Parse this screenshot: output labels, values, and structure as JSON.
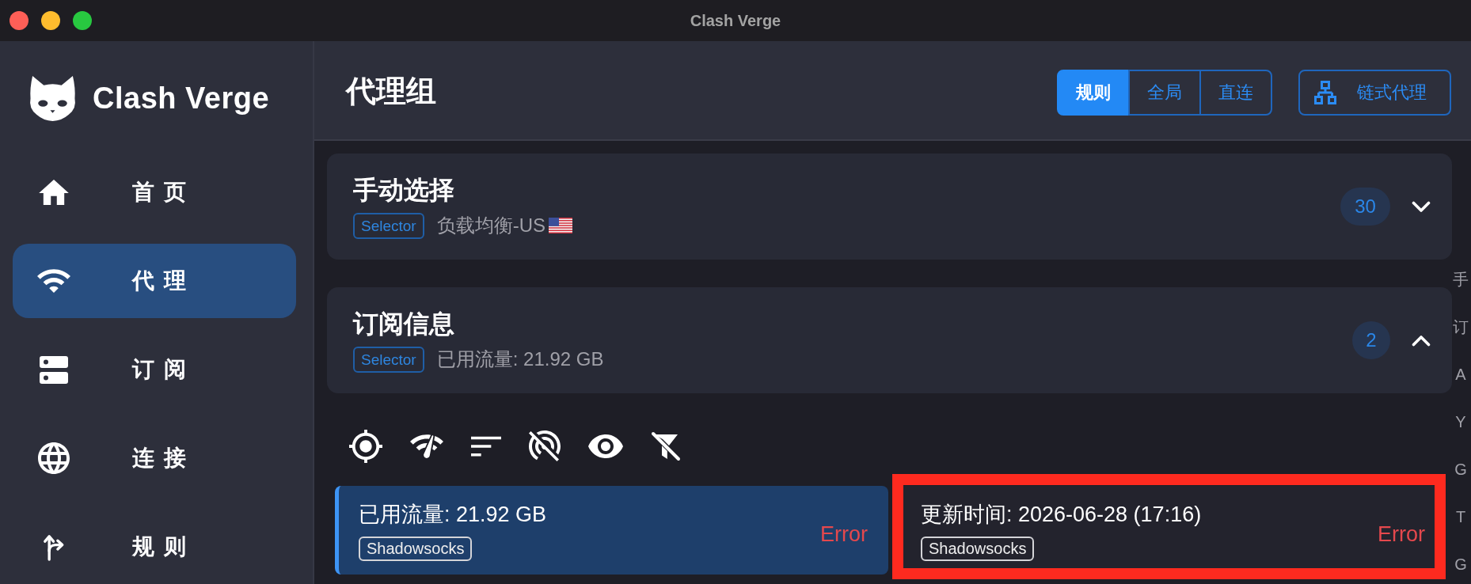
{
  "window": {
    "title": "Clash Verge"
  },
  "sidebar": {
    "app_name": "Clash Verge",
    "items": [
      {
        "label": "首页",
        "selected": false
      },
      {
        "label": "代理",
        "selected": true
      },
      {
        "label": "订阅",
        "selected": false
      },
      {
        "label": "连接",
        "selected": false
      },
      {
        "label": "规则",
        "selected": false
      }
    ]
  },
  "header": {
    "title": "代理组",
    "modes": [
      {
        "label": "规则",
        "selected": true
      },
      {
        "label": "全局",
        "selected": false
      },
      {
        "label": "直连",
        "selected": false
      }
    ],
    "chain_button": "链式代理"
  },
  "groups": [
    {
      "name": "手动选择",
      "type": "Selector",
      "current": "负载均衡-US",
      "flag": true,
      "count": "30",
      "expanded": false
    },
    {
      "name": "订阅信息",
      "type": "Selector",
      "current": "已用流量: 21.92 GB",
      "flag": false,
      "count": "2",
      "expanded": true
    }
  ],
  "proxies": [
    {
      "name": "已用流量: 21.92 GB",
      "type": "Shadowsocks",
      "delay": "Error",
      "selected": true,
      "highlighted": false
    },
    {
      "name": "更新时间: 2026-06-28 (17:16)",
      "type": "Shadowsocks",
      "delay": "Error",
      "selected": false,
      "highlighted": true
    }
  ],
  "index_letters": [
    "手",
    "订",
    "A",
    "Y",
    "G",
    "T",
    "G"
  ]
}
